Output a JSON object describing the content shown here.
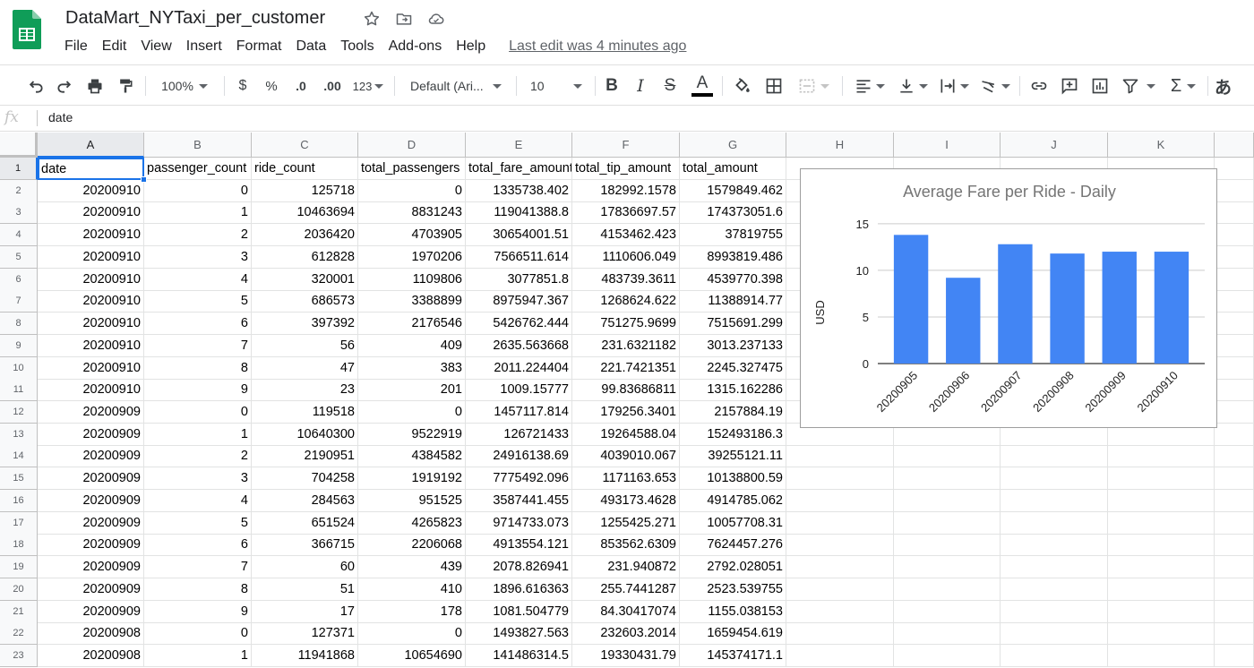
{
  "document": {
    "title": "DataMart_NYTaxi_per_customer",
    "last_edit": "Last edit was 4 minutes ago"
  },
  "menu": [
    "File",
    "Edit",
    "View",
    "Insert",
    "Format",
    "Data",
    "Tools",
    "Add-ons",
    "Help"
  ],
  "toolbar": {
    "zoom": "100%",
    "currency": "$",
    "percent": "%",
    "decrease_decimal": ".0",
    "increase_decimal": ".00",
    "number_format": "123",
    "font": "Default (Ari...",
    "font_size": "10",
    "bold": "B",
    "italic": "I",
    "strikethrough": "S",
    "text_color": "A",
    "input_tools": "あ",
    "text_color_bar": "#000000"
  },
  "formula_bar": {
    "fx": "fx",
    "content": "date"
  },
  "selected_cell": {
    "col": "A",
    "row": 1
  },
  "columns": [
    "A",
    "B",
    "C",
    "D",
    "E",
    "F",
    "G",
    "H",
    "I",
    "J",
    "K"
  ],
  "row_numbers": [
    "1",
    "2",
    "3",
    "4",
    "5",
    "6",
    "7",
    "8",
    "9",
    "10",
    "11",
    "12",
    "13",
    "14",
    "15",
    "16",
    "17",
    "18",
    "19",
    "20",
    "21",
    "22",
    "23"
  ],
  "rows": [
    [
      "date",
      "passenger_count",
      "ride_count",
      "total_passengers",
      "total_fare_amount",
      "total_tip_amount",
      "total_amount"
    ],
    [
      "20200910",
      "0",
      "125718",
      "0",
      "1335738.402",
      "182992.1578",
      "1579849.462"
    ],
    [
      "20200910",
      "1",
      "10463694",
      "8831243",
      "119041388.8",
      "17836697.57",
      "174373051.6"
    ],
    [
      "20200910",
      "2",
      "2036420",
      "4703905",
      "30654001.51",
      "4153462.423",
      "37819755"
    ],
    [
      "20200910",
      "3",
      "612828",
      "1970206",
      "7566511.614",
      "1110606.049",
      "8993819.486"
    ],
    [
      "20200910",
      "4",
      "320001",
      "1109806",
      "3077851.8",
      "483739.3611",
      "4539770.398"
    ],
    [
      "20200910",
      "5",
      "686573",
      "3388899",
      "8975947.367",
      "1268624.622",
      "11388914.77"
    ],
    [
      "20200910",
      "6",
      "397392",
      "2176546",
      "5426762.444",
      "751275.9699",
      "7515691.299"
    ],
    [
      "20200910",
      "7",
      "56",
      "409",
      "2635.563668",
      "231.6321182",
      "3013.237133"
    ],
    [
      "20200910",
      "8",
      "47",
      "383",
      "2011.224404",
      "221.7421351",
      "2245.327475"
    ],
    [
      "20200910",
      "9",
      "23",
      "201",
      "1009.15777",
      "99.83686811",
      "1315.162286"
    ],
    [
      "20200909",
      "0",
      "119518",
      "0",
      "1457117.814",
      "179256.3401",
      "2157884.19"
    ],
    [
      "20200909",
      "1",
      "10640300",
      "9522919",
      "126721433",
      "19264588.04",
      "152493186.3"
    ],
    [
      "20200909",
      "2",
      "2190951",
      "4384582",
      "24916138.69",
      "4039010.067",
      "39255121.11"
    ],
    [
      "20200909",
      "3",
      "704258",
      "1919192",
      "7775492.096",
      "1171163.653",
      "10138800.59"
    ],
    [
      "20200909",
      "4",
      "284563",
      "951525",
      "3587441.455",
      "493173.4628",
      "4914785.062"
    ],
    [
      "20200909",
      "5",
      "651524",
      "4265823",
      "9714733.073",
      "1255425.271",
      "10057708.31"
    ],
    [
      "20200909",
      "6",
      "366715",
      "2206068",
      "4913554.121",
      "853562.6309",
      "7624457.276"
    ],
    [
      "20200909",
      "7",
      "60",
      "439",
      "2078.826941",
      "231.940872",
      "2792.028051"
    ],
    [
      "20200909",
      "8",
      "51",
      "410",
      "1896.616363",
      "255.7441287",
      "2523.539755"
    ],
    [
      "20200909",
      "9",
      "17",
      "178",
      "1081.504779",
      "84.30417074",
      "1155.038153"
    ],
    [
      "20200908",
      "0",
      "127371",
      "0",
      "1493827.563",
      "232603.2014",
      "1659454.619"
    ],
    [
      "20200908",
      "1",
      "11941868",
      "10654690",
      "141486314.5",
      "19330431.79",
      "145374171.1"
    ]
  ],
  "chart_data": {
    "type": "bar",
    "title": "Average Fare per Ride - Daily",
    "xlabel": "",
    "ylabel": "USD",
    "categories": [
      "20200905",
      "20200906",
      "20200907",
      "20200908",
      "20200909",
      "20200910"
    ],
    "values": [
      13.8,
      9.2,
      12.8,
      11.8,
      12.0,
      12.0
    ],
    "yticks": [
      "0",
      "5",
      "10",
      "15"
    ],
    "ylim": [
      0,
      17
    ],
    "grid": true,
    "legend": "none",
    "bar_color": "#4285f4"
  }
}
